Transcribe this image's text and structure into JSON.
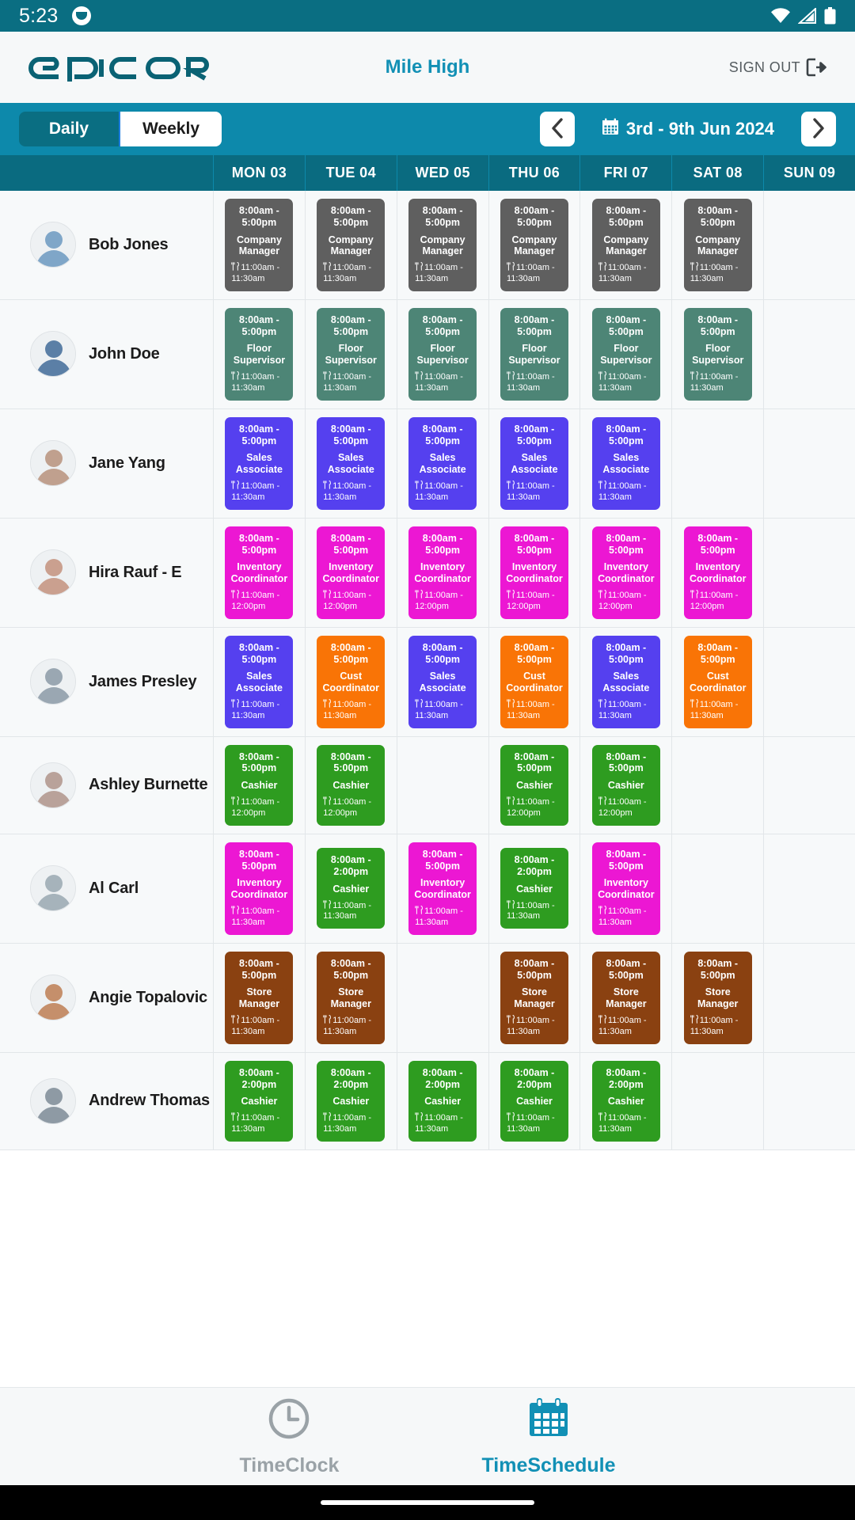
{
  "status_bar": {
    "time": "5:23",
    "app_icon": "app-badge-icon",
    "icons": [
      "wifi-icon",
      "signal-icon",
      "battery-icon"
    ]
  },
  "header": {
    "logo_text": "EPICOR",
    "site_name": "Mile High",
    "sign_out_label": "SIGN OUT",
    "sign_out_icon": "sign-out-icon"
  },
  "toolbar": {
    "daily_label": "Daily",
    "weekly_label": "Weekly",
    "active_view": "Daily",
    "prev_icon": "chevron-left-icon",
    "next_icon": "chevron-right-icon",
    "calendar_icon": "calendar-icon",
    "date_range": "3rd - 9th Jun 2024"
  },
  "colors": {
    "status_bar": "#0a6e82",
    "brand_teal": "#0a6e82",
    "toolbar": "#0d89ab",
    "header_row": "#0a6b80",
    "accent_link": "#1290b5",
    "role_company_manager": "#5f5f5f",
    "role_floor_supervisor": "#4d8576",
    "role_sales_associate": "#5540ef",
    "role_inventory_coordinator": "#ec17d3",
    "role_cust_coordinator": "#f97406",
    "role_cashier": "#2e9c20",
    "role_store_manager": "#8a4111"
  },
  "grid": {
    "employee_col_header": "",
    "days": [
      "MON 03",
      "TUE 04",
      "WED 05",
      "THU 06",
      "FRI 07",
      "SAT 08",
      "SUN 09"
    ],
    "rows": [
      {
        "name": "Bob Jones",
        "avatar": "avatar-bob-jones",
        "shifts": [
          {
            "time": "8:00am - 5:00pm",
            "role": "Company Manager",
            "break": "11:00am - 11:30am",
            "color": "#5f5f5f"
          },
          {
            "time": "8:00am - 5:00pm",
            "role": "Company Manager",
            "break": "11:00am - 11:30am",
            "color": "#5f5f5f"
          },
          {
            "time": "8:00am - 5:00pm",
            "role": "Company Manager",
            "break": "11:00am - 11:30am",
            "color": "#5f5f5f"
          },
          {
            "time": "8:00am - 5:00pm",
            "role": "Company Manager",
            "break": "11:00am - 11:30am",
            "color": "#5f5f5f"
          },
          {
            "time": "8:00am - 5:00pm",
            "role": "Company Manager",
            "break": "11:00am - 11:30am",
            "color": "#5f5f5f"
          },
          {
            "time": "8:00am - 5:00pm",
            "role": "Company Manager",
            "break": "11:00am - 11:30am",
            "color": "#5f5f5f"
          },
          null
        ]
      },
      {
        "name": "John Doe",
        "avatar": "avatar-john-doe",
        "shifts": [
          {
            "time": "8:00am - 5:00pm",
            "role": "Floor Supervisor",
            "break": "11:00am - 11:30am",
            "color": "#4d8576"
          },
          {
            "time": "8:00am - 5:00pm",
            "role": "Floor Supervisor",
            "break": "11:00am - 11:30am",
            "color": "#4d8576"
          },
          {
            "time": "8:00am - 5:00pm",
            "role": "Floor Supervisor",
            "break": "11:00am - 11:30am",
            "color": "#4d8576"
          },
          {
            "time": "8:00am - 5:00pm",
            "role": "Floor Supervisor",
            "break": "11:00am - 11:30am",
            "color": "#4d8576"
          },
          {
            "time": "8:00am - 5:00pm",
            "role": "Floor Supervisor",
            "break": "11:00am - 11:30am",
            "color": "#4d8576"
          },
          {
            "time": "8:00am - 5:00pm",
            "role": "Floor Supervisor",
            "break": "11:00am - 11:30am",
            "color": "#4d8576"
          },
          null
        ]
      },
      {
        "name": "Jane Yang",
        "avatar": "avatar-jane-yang",
        "shifts": [
          {
            "time": "8:00am - 5:00pm",
            "role": "Sales Associate",
            "break": "11:00am - 11:30am",
            "color": "#5540ef"
          },
          {
            "time": "8:00am - 5:00pm",
            "role": "Sales Associate",
            "break": "11:00am - 11:30am",
            "color": "#5540ef"
          },
          {
            "time": "8:00am - 5:00pm",
            "role": "Sales Associate",
            "break": "11:00am - 11:30am",
            "color": "#5540ef"
          },
          {
            "time": "8:00am - 5:00pm",
            "role": "Sales Associate",
            "break": "11:00am - 11:30am",
            "color": "#5540ef"
          },
          {
            "time": "8:00am - 5:00pm",
            "role": "Sales Associate",
            "break": "11:00am - 11:30am",
            "color": "#5540ef"
          },
          null,
          null
        ]
      },
      {
        "name": "Hira Rauf - E",
        "avatar": "avatar-hira-rauf",
        "shifts": [
          {
            "time": "8:00am - 5:00pm",
            "role": "Inventory Coordinator",
            "break": "11:00am - 12:00pm",
            "color": "#ec17d3"
          },
          {
            "time": "8:00am - 5:00pm",
            "role": "Inventory Coordinator",
            "break": "11:00am - 12:00pm",
            "color": "#ec17d3"
          },
          {
            "time": "8:00am - 5:00pm",
            "role": "Inventory Coordinator",
            "break": "11:00am - 12:00pm",
            "color": "#ec17d3"
          },
          {
            "time": "8:00am - 5:00pm",
            "role": "Inventory Coordinator",
            "break": "11:00am - 12:00pm",
            "color": "#ec17d3"
          },
          {
            "time": "8:00am - 5:00pm",
            "role": "Inventory Coordinator",
            "break": "11:00am - 12:00pm",
            "color": "#ec17d3"
          },
          {
            "time": "8:00am - 5:00pm",
            "role": "Inventory Coordinator",
            "break": "11:00am - 12:00pm",
            "color": "#ec17d3"
          },
          null
        ]
      },
      {
        "name": "James Presley",
        "avatar": "avatar-james-presley",
        "shifts": [
          {
            "time": "8:00am - 5:00pm",
            "role": "Sales Associate",
            "break": "11:00am - 11:30am",
            "color": "#5540ef"
          },
          {
            "time": "8:00am - 5:00pm",
            "role": "Cust Coordinator",
            "break": "11:00am - 11:30am",
            "color": "#f97406"
          },
          {
            "time": "8:00am - 5:00pm",
            "role": "Sales Associate",
            "break": "11:00am - 11:30am",
            "color": "#5540ef"
          },
          {
            "time": "8:00am - 5:00pm",
            "role": "Cust Coordinator",
            "break": "11:00am - 11:30am",
            "color": "#f97406"
          },
          {
            "time": "8:00am - 5:00pm",
            "role": "Sales Associate",
            "break": "11:00am - 11:30am",
            "color": "#5540ef"
          },
          {
            "time": "8:00am - 5:00pm",
            "role": "Cust Coordinator",
            "break": "11:00am - 11:30am",
            "color": "#f97406"
          },
          null
        ]
      },
      {
        "name": "Ashley Burnette",
        "avatar": "avatar-ashley-burnette",
        "shifts": [
          {
            "time": "8:00am - 5:00pm",
            "role": "Cashier",
            "break": "11:00am - 12:00pm",
            "color": "#2e9c20"
          },
          {
            "time": "8:00am - 5:00pm",
            "role": "Cashier",
            "break": "11:00am - 12:00pm",
            "color": "#2e9c20"
          },
          null,
          {
            "time": "8:00am - 5:00pm",
            "role": "Cashier",
            "break": "11:00am - 12:00pm",
            "color": "#2e9c20"
          },
          {
            "time": "8:00am - 5:00pm",
            "role": "Cashier",
            "break": "11:00am - 12:00pm",
            "color": "#2e9c20"
          },
          null,
          null
        ]
      },
      {
        "name": "Al Carl",
        "avatar": "avatar-al-carl",
        "shifts": [
          {
            "time": "8:00am - 5:00pm",
            "role": "Inventory Coordinator",
            "break": "11:00am - 11:30am",
            "color": "#ec17d3"
          },
          {
            "time": "8:00am - 2:00pm",
            "role": "Cashier",
            "break": "11:00am - 11:30am",
            "color": "#2e9c20"
          },
          {
            "time": "8:00am - 5:00pm",
            "role": "Inventory Coordinator",
            "break": "11:00am - 11:30am",
            "color": "#ec17d3"
          },
          {
            "time": "8:00am - 2:00pm",
            "role": "Cashier",
            "break": "11:00am - 11:30am",
            "color": "#2e9c20"
          },
          {
            "time": "8:00am - 5:00pm",
            "role": "Inventory Coordinator",
            "break": "11:00am - 11:30am",
            "color": "#ec17d3"
          },
          null,
          null
        ]
      },
      {
        "name": "Angie Topalovic",
        "avatar": "avatar-angie-topalovic",
        "shifts": [
          {
            "time": "8:00am - 5:00pm",
            "role": "Store Manager",
            "break": "11:00am - 11:30am",
            "color": "#8a4111"
          },
          {
            "time": "8:00am - 5:00pm",
            "role": "Store Manager",
            "break": "11:00am - 11:30am",
            "color": "#8a4111"
          },
          null,
          {
            "time": "8:00am - 5:00pm",
            "role": "Store Manager",
            "break": "11:00am - 11:30am",
            "color": "#8a4111"
          },
          {
            "time": "8:00am - 5:00pm",
            "role": "Store Manager",
            "break": "11:00am - 11:30am",
            "color": "#8a4111"
          },
          {
            "time": "8:00am - 5:00pm",
            "role": "Store Manager",
            "break": "11:00am - 11:30am",
            "color": "#8a4111"
          },
          null
        ]
      },
      {
        "name": "Andrew Thomas",
        "avatar": "avatar-andrew-thomas",
        "shifts": [
          {
            "time": "8:00am - 2:00pm",
            "role": "Cashier",
            "break": "11:00am - 11:30am",
            "color": "#2e9c20"
          },
          {
            "time": "8:00am - 2:00pm",
            "role": "Cashier",
            "break": "11:00am - 11:30am",
            "color": "#2e9c20"
          },
          {
            "time": "8:00am - 2:00pm",
            "role": "Cashier",
            "break": "11:00am - 11:30am",
            "color": "#2e9c20"
          },
          {
            "time": "8:00am - 2:00pm",
            "role": "Cashier",
            "break": "11:00am - 11:30am",
            "color": "#2e9c20"
          },
          {
            "time": "8:00am - 2:00pm",
            "role": "Cashier",
            "break": "11:00am - 11:30am",
            "color": "#2e9c20"
          },
          null,
          null
        ]
      }
    ]
  },
  "bottom_nav": {
    "items": [
      {
        "label": "TimeClock",
        "icon": "clock-icon",
        "active": false
      },
      {
        "label": "TimeSchedule",
        "icon": "calendar-icon",
        "active": true
      }
    ]
  }
}
